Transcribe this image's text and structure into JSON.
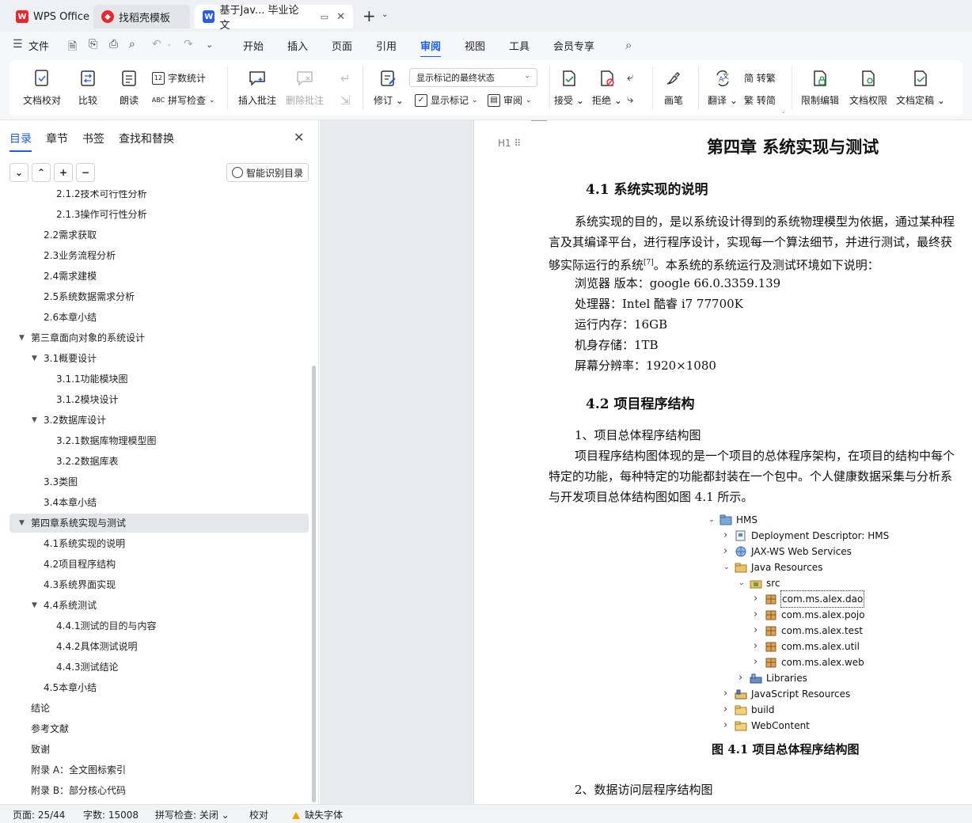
{
  "tabs": [
    {
      "label": "WPS Office",
      "icon": "wps-logo-icon",
      "color": "#e8262c"
    },
    {
      "label": "找稻壳模板",
      "icon": "docer-icon",
      "color": "#e8262c"
    },
    {
      "label": "基于Jav... 毕业论文",
      "icon": "writer-doc-icon",
      "color": "#2b5ce6"
    }
  ],
  "menu": {
    "file": "文件",
    "items": [
      "开始",
      "插入",
      "页面",
      "引用",
      "审阅",
      "视图",
      "工具",
      "会员专享"
    ],
    "active": "审阅"
  },
  "ribbon": {
    "proofread": "文档校对",
    "compare": "比较",
    "read_aloud": "朗读",
    "word_count": "字数统计",
    "spell_check": "拼写检查",
    "insert_comment": "插入批注",
    "delete_comment": "删除批注",
    "track_changes": "修订",
    "markup_state": "显示标记的最终状态",
    "show_markup": "显示标记",
    "review": "审阅",
    "accept": "接受",
    "reject": "拒绝",
    "pen": "画笔",
    "translate": "翻译",
    "to_traditional": "简 转繁",
    "to_simplified": "繁 转简",
    "restrict_edit": "限制编辑",
    "doc_permission": "文档权限",
    "finalize": "文档定稿"
  },
  "nav": {
    "tabs": [
      "目录",
      "章节",
      "书签",
      "查找和替换"
    ],
    "active_tab": "目录",
    "smart_toc": "智能识别目录",
    "toc": [
      {
        "label": "2.1.2技术可行性分析",
        "level": 3,
        "toggle": ""
      },
      {
        "label": "2.1.3操作可行性分析",
        "level": 3,
        "toggle": ""
      },
      {
        "label": "2.2需求获取",
        "level": 2,
        "toggle": ""
      },
      {
        "label": "2.3业务流程分析",
        "level": 2,
        "toggle": ""
      },
      {
        "label": "2.4需求建模",
        "level": 2,
        "toggle": ""
      },
      {
        "label": "2.5系统数据需求分析",
        "level": 2,
        "toggle": ""
      },
      {
        "label": "2.6本章小结",
        "level": 2,
        "toggle": ""
      },
      {
        "label": "第三章面向对象的系统设计",
        "level": 1,
        "toggle": "▼"
      },
      {
        "label": "3.1概要设计",
        "level": 2,
        "toggle": "▼"
      },
      {
        "label": "3.1.1功能模块图",
        "level": 3,
        "toggle": ""
      },
      {
        "label": "3.1.2模块设计",
        "level": 3,
        "toggle": ""
      },
      {
        "label": "3.2数据库设计",
        "level": 2,
        "toggle": "▼"
      },
      {
        "label": "3.2.1数据库物理模型图",
        "level": 3,
        "toggle": ""
      },
      {
        "label": "3.2.2数据库表",
        "level": 3,
        "toggle": ""
      },
      {
        "label": "3.3类图",
        "level": 2,
        "toggle": ""
      },
      {
        "label": "3.4本章小结",
        "level": 2,
        "toggle": ""
      },
      {
        "label": "第四章系统实现与测试",
        "level": 1,
        "toggle": "▼",
        "selected": true
      },
      {
        "label": "4.1系统实现的说明",
        "level": 2,
        "toggle": ""
      },
      {
        "label": "4.2项目程序结构",
        "level": 2,
        "toggle": ""
      },
      {
        "label": "4.3系统界面实现",
        "level": 2,
        "toggle": ""
      },
      {
        "label": "4.4系统测试",
        "level": 2,
        "toggle": "▼"
      },
      {
        "label": "4.4.1测试的目的与内容",
        "level": 3,
        "toggle": ""
      },
      {
        "label": "4.4.2具体测试说明",
        "level": 3,
        "toggle": ""
      },
      {
        "label": "4.4.3测试结论",
        "level": 3,
        "toggle": ""
      },
      {
        "label": "4.5本章小结",
        "level": 2,
        "toggle": ""
      },
      {
        "label": "结论",
        "level": 1,
        "toggle": ""
      },
      {
        "label": "参考文献",
        "level": 1,
        "toggle": ""
      },
      {
        "label": "致谢",
        "level": 1,
        "toggle": ""
      },
      {
        "label": "附录 A：全文图标索引",
        "level": 1,
        "toggle": ""
      },
      {
        "label": "附录 B：部分核心代码",
        "level": 1,
        "toggle": ""
      }
    ]
  },
  "doc": {
    "heading_marker": "H1",
    "chapter_title": "第四章  系统实现与测试",
    "s41_title": "4.1  系统实现的说明",
    "s41_p1_l1": "系统实现的目的，是以系统设计得到的系统物理模型为依据，通过某种程",
    "s41_p1_l2": "言及其编译平台，进行程序设计，实现每一个算法细节，并进行测试，最终获",
    "s41_p1_l3": "够实际运行的系统",
    "s41_p1_ref": "[7]",
    "s41_p1_l3b": "。本系统的系统运行及测试环境如下说明：",
    "env": [
      "浏览器 版本：google 66.0.3359.139",
      "处理器：Intel 酷睿 i7 77700K",
      "运行内存：16GB",
      "机身存储：1TB",
      "屏幕分辨率：1920×1080"
    ],
    "s42_title": "4.2  项目程序结构",
    "item1": "1、项目总体程序结构图",
    "s42_p1_l1": "项目程序结构图体现的是一个项目的总体程序架构，在项目的结构中每个",
    "s42_p1_l2": "特定的功能，每种特定的功能都封装在一个包中。个人健康数据采集与分析系",
    "s42_p1_l3": "与开发项目总体结构图如图  4.1 所示。",
    "tree": [
      {
        "label": "HMS",
        "indent": 0,
        "toggle": "v",
        "icon": "project-icon"
      },
      {
        "label": "Deployment Descriptor: HMS",
        "indent": 1,
        "toggle": ">",
        "icon": "deployment-descriptor-icon"
      },
      {
        "label": "JAX-WS Web Services",
        "indent": 1,
        "toggle": ">",
        "icon": "web-services-icon"
      },
      {
        "label": "Java Resources",
        "indent": 1,
        "toggle": "v",
        "icon": "java-resources-icon"
      },
      {
        "label": "src",
        "indent": 2,
        "toggle": "v",
        "icon": "source-folder-icon"
      },
      {
        "label": "com.ms.alex.dao",
        "indent": 3,
        "toggle": ">",
        "icon": "package-icon",
        "selected": true
      },
      {
        "label": "com.ms.alex.pojo",
        "indent": 3,
        "toggle": ">",
        "icon": "package-icon"
      },
      {
        "label": "com.ms.alex.test",
        "indent": 3,
        "toggle": ">",
        "icon": "package-icon"
      },
      {
        "label": "com.ms.alex.util",
        "indent": 3,
        "toggle": ">",
        "icon": "package-icon"
      },
      {
        "label": "com.ms.alex.web",
        "indent": 3,
        "toggle": ">",
        "icon": "package-icon"
      },
      {
        "label": "Libraries",
        "indent": 2,
        "toggle": ">",
        "icon": "libraries-icon"
      },
      {
        "label": "JavaScript Resources",
        "indent": 1,
        "toggle": ">",
        "icon": "javascript-resources-icon"
      },
      {
        "label": "build",
        "indent": 1,
        "toggle": ">",
        "icon": "folder-icon"
      },
      {
        "label": "WebContent",
        "indent": 1,
        "toggle": ">",
        "icon": "folder-icon"
      }
    ],
    "figure_caption": "图  4.1 项目总体程序结构图",
    "item2": "2、数据访问层程序结构图"
  },
  "status": {
    "page": "页面: 25/44",
    "words": "字数: 15008",
    "spell": "拼写检查: 关闭",
    "proof": "校对",
    "missing_font": "缺失字体"
  },
  "colors": {
    "accent": "#1a5cf0",
    "wps_red": "#e8262c",
    "writer_blue": "#2b5ce6",
    "warning": "#f0a400"
  }
}
